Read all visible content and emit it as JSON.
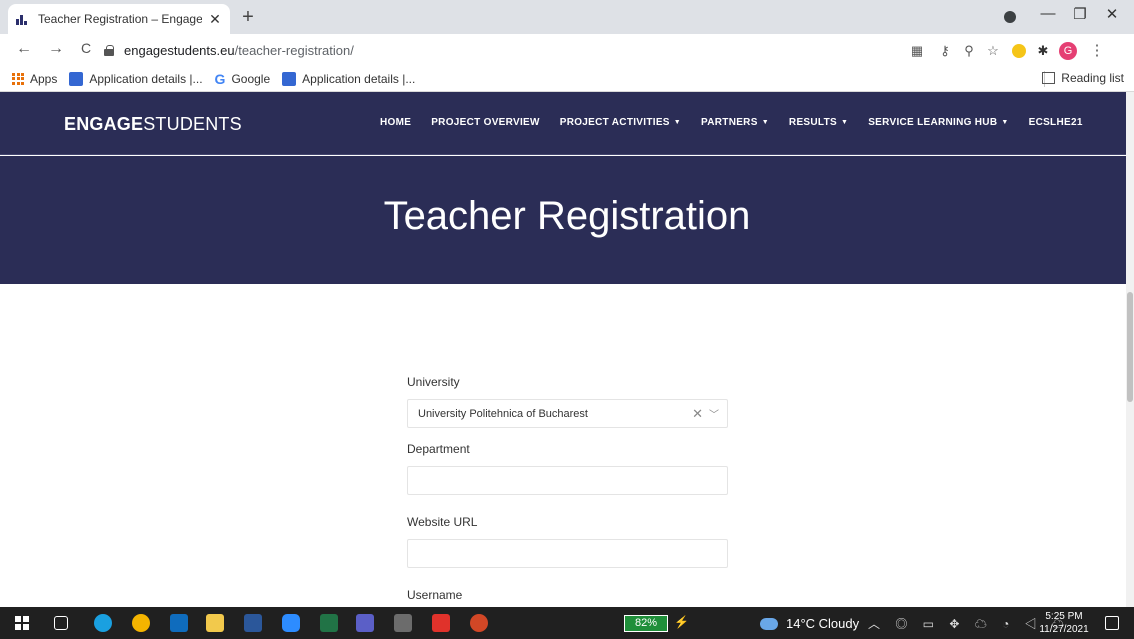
{
  "browser": {
    "tab": {
      "title": "Teacher Registration – EngageStu",
      "close": "✕"
    },
    "new_tab": "+",
    "window_controls": {
      "minimize": "—",
      "restore": "❐",
      "close": "✕"
    },
    "nav": {
      "back": "←",
      "forward": "→",
      "reload": "C"
    },
    "url": {
      "host": "engagestudents.eu",
      "path": "/teacher-registration/"
    },
    "toolbar_icons": [
      "apps-icon",
      "key-icon",
      "zoom-icon",
      "star-icon",
      "extension-icon",
      "puzzle-icon"
    ],
    "profile_initial": "G",
    "more": "⋮"
  },
  "bookmarks": {
    "items": [
      {
        "label": "Apps",
        "icon": "apps-grid-icon"
      },
      {
        "label": "Application details |...",
        "icon": "globe-icon"
      },
      {
        "label": "Google",
        "icon": "google-icon"
      },
      {
        "label": "Application details |...",
        "icon": "globe-icon"
      }
    ],
    "reading_list": "Reading list"
  },
  "site": {
    "brand_bold": "ENGAGE",
    "brand_light": "STUDENTS",
    "menu": [
      {
        "label": "HOME",
        "dropdown": false
      },
      {
        "label": "PROJECT OVERVIEW",
        "dropdown": false
      },
      {
        "label": "PROJECT ACTIVITIES",
        "dropdown": true
      },
      {
        "label": "PARTNERS",
        "dropdown": true
      },
      {
        "label": "RESULTS",
        "dropdown": true
      },
      {
        "label": "SERVICE LEARNING HUB",
        "dropdown": true
      },
      {
        "label": "ECSLHE21",
        "dropdown": false
      }
    ],
    "hero_title": "Teacher Registration"
  },
  "form": {
    "university": {
      "label": "University",
      "value": "University Politehnica of Bucharest"
    },
    "department": {
      "label": "Department",
      "value": ""
    },
    "website": {
      "label": "Website URL",
      "value": ""
    },
    "username": {
      "label": "Username",
      "value": ""
    }
  },
  "taskbar": {
    "battery": "82%",
    "weather": "14°C  Cloudy",
    "time": "5:25 PM",
    "date": "11/27/2021"
  },
  "colors": {
    "nav_bg": "#2b2d56",
    "accent": "#e53f73"
  }
}
